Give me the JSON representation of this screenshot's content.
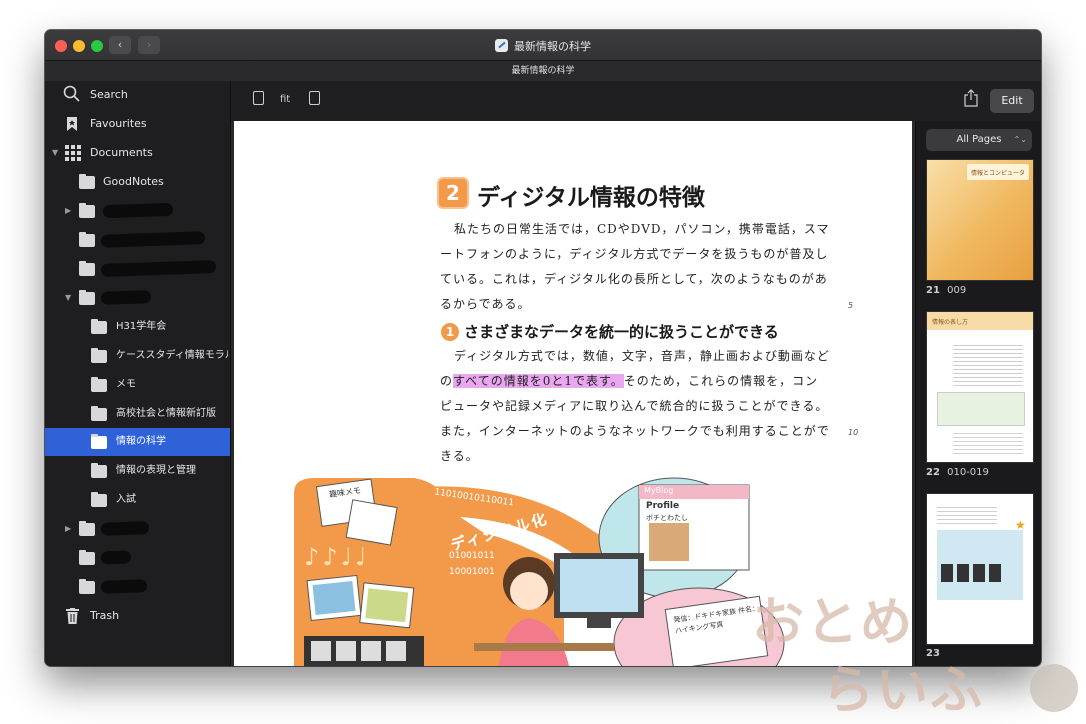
{
  "window": {
    "title": "最新情報の科学",
    "tab_title": "最新情報の科学",
    "back_glyph": "‹",
    "forward_glyph": "›"
  },
  "colors": {
    "accent": "#2f62d9",
    "close": "#ff5f57",
    "minimize": "#febc2e",
    "zoom": "#28c840",
    "orange": "#f29a4a",
    "highlight": "#e9a7ef"
  },
  "sidebar": {
    "items": [
      {
        "label": "Search",
        "icon": "search-icon"
      },
      {
        "label": "Favourites",
        "icon": "bookmark-icon"
      },
      {
        "label": "Documents",
        "icon": "grid-icon"
      },
      {
        "label": "GoodNotes",
        "icon": "folder-icon"
      },
      {
        "label": "H31学年会",
        "icon": "folder-icon"
      },
      {
        "label": "ケーススタディ情報モラル",
        "icon": "folder-icon"
      },
      {
        "label": "メモ",
        "icon": "folder-icon"
      },
      {
        "label": "高校社会と情報新訂版",
        "icon": "folder-icon"
      },
      {
        "label": "情報の科学",
        "icon": "folder-icon"
      },
      {
        "label": "情報の表現と管理",
        "icon": "folder-icon"
      },
      {
        "label": "入試",
        "icon": "folder-icon"
      },
      {
        "label": "Trash",
        "icon": "trash-icon"
      }
    ]
  },
  "toolbar": {
    "fit_label": "fit",
    "edit_label": "Edit"
  },
  "thumbnails": {
    "filter_label": "All Pages",
    "filter_chevron": "⌃⌄",
    "pages": [
      {
        "num": "21",
        "range": "009",
        "heading": "情報とコンピュータ"
      },
      {
        "num": "22",
        "range": "010-019",
        "heading": "情報の表し方"
      },
      {
        "num": "23",
        "range": ""
      }
    ]
  },
  "page": {
    "section_number": "2",
    "section_title": "ディジタル情報の特徴",
    "paragraph1": "私たちの日常生活では，CDやDVD，パソコン，携帯電話，スマートフォンのように，ディジタル方式でデータを扱うものが普及している。これは，ディジタル化の長所として，次のようなものがあるからである。",
    "line_mark_5": "5",
    "sub_number": "1",
    "sub_title": "さまざまなデータを統一的に扱うことができる",
    "para2_before": "ディジタル方式では，数値，文字，音声，静止画および動画などの",
    "para2_highlight": "すべての情報を0と1で表す。",
    "para2_after": "そのため，これらの情報を，コンピュータや記録メディアに取り込んで統合的に扱うことができる。また，インターネットのようなネットワークでも利用することができる。",
    "line_mark_10": "10",
    "illus": {
      "memo_label": "趣味メモ",
      "digital_label": "ディジタル化",
      "binary1": "11010010110011",
      "binary2": "01001011",
      "binary3": "10001001",
      "notes": "♪♪♩♩",
      "blog_header": "MyBlog",
      "blog_profile": "Profile",
      "blog_sub": "ボチとわたし",
      "card_text": "発信：ドキドキ家族 件名：ハイキング写真"
    }
  },
  "watermark": {
    "line1": "おとめ",
    "line2": "らいふ"
  }
}
